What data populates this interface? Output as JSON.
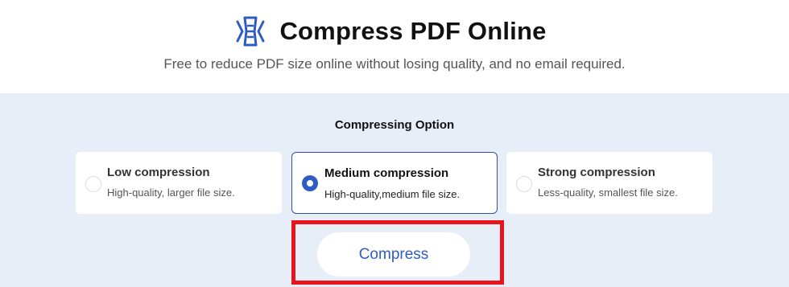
{
  "header": {
    "logo_icon": "compress-pdf-icon",
    "title": "Compress PDF Online",
    "subtitle": "Free to reduce PDF size online without losing quality, and no email required."
  },
  "options": {
    "heading": "Compressing Option",
    "selected": "medium",
    "items": [
      {
        "id": "low",
        "title": "Low compression",
        "description": "High-quality, larger file size.",
        "selected": false
      },
      {
        "id": "medium",
        "title": "Medium compression",
        "description": "High-quality,medium file size.",
        "selected": true
      },
      {
        "id": "strong",
        "title": "Strong compression",
        "description": "Less-quality, smallest file size.",
        "selected": false
      }
    ]
  },
  "actions": {
    "compress_label": "Compress"
  },
  "colors": {
    "accent": "#2f5cc4",
    "panel_background": "#e8eef8",
    "highlight": "#e8141c"
  }
}
